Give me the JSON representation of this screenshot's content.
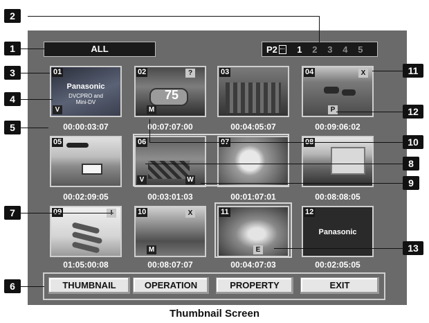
{
  "header": {
    "view_label": "ALL",
    "card": "P2",
    "slots": [
      "1",
      "2",
      "3",
      "4",
      "5"
    ],
    "active_slot": "1"
  },
  "thumbnails": [
    {
      "num": "01",
      "timecode": "00:00:03:07",
      "badges": [
        "V"
      ],
      "text": [
        "Panasonic",
        "DVCPRO and",
        "Mini-DV"
      ]
    },
    {
      "num": "02",
      "timecode": "00:07:07:00",
      "badges": [
        "?",
        "M"
      ],
      "text": [
        "75"
      ]
    },
    {
      "num": "03",
      "timecode": "00:04:05:07",
      "badges": []
    },
    {
      "num": "04",
      "timecode": "00:09:06:02",
      "badges": [
        "X",
        "P"
      ]
    },
    {
      "num": "05",
      "timecode": "00:02:09:05",
      "badges": []
    },
    {
      "num": "06",
      "timecode": "00:03:01:03",
      "badges": [
        "V",
        "W"
      ]
    },
    {
      "num": "07",
      "timecode": "00:01:07:01",
      "badges": []
    },
    {
      "num": "08",
      "timecode": "00:08:08:05",
      "badges": []
    },
    {
      "num": "09",
      "timecode": "01:05:00:08",
      "badges": [
        "!"
      ]
    },
    {
      "num": "10",
      "timecode": "00:08:07:07",
      "badges": [
        "X",
        "M"
      ]
    },
    {
      "num": "11",
      "timecode": "00:04:07:03",
      "badges": [
        "E"
      ]
    },
    {
      "num": "12",
      "timecode": "00:02:05:05",
      "badges": [],
      "text": [
        "Panasonic"
      ]
    }
  ],
  "buttons": {
    "thumbnail": "THUMBNAIL",
    "operation": "OPERATION",
    "property": "PROPERTY",
    "exit": "EXIT"
  },
  "callouts": [
    "1",
    "2",
    "3",
    "4",
    "5",
    "6",
    "7",
    "8",
    "9",
    "10",
    "11",
    "12",
    "13"
  ],
  "caption": "Thumbnail Screen",
  "colors": {
    "panel": "#6a6a6a",
    "header_bg": "#1a1a1a",
    "button_bg": "#e6e6e6",
    "badge_bg": "#c8c8c8"
  }
}
